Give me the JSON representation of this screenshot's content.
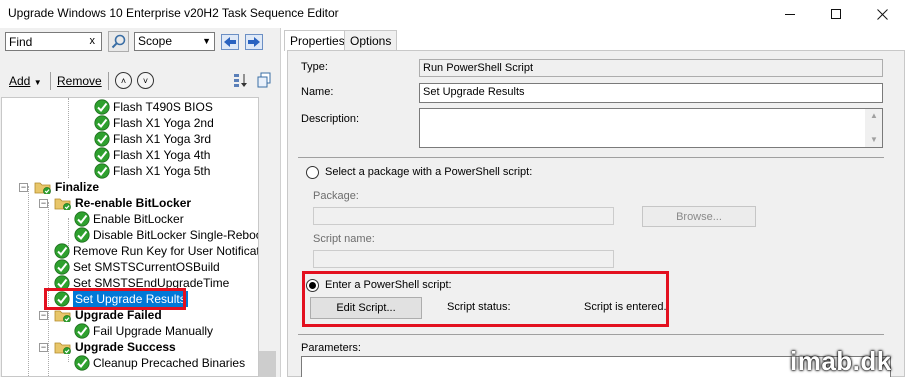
{
  "window": {
    "title": "Upgrade Windows 10 Enterprise v20H2 Task Sequence Editor",
    "controls": [
      "minimize-icon",
      "maximize-icon",
      "close-icon"
    ]
  },
  "search": {
    "value": "Find",
    "clear_label": "x",
    "scope_value": "Scope"
  },
  "toolbar": {
    "add_label": "Add",
    "remove_label": "Remove"
  },
  "tree": {
    "items": [
      {
        "label": "Flash T490S BIOS",
        "type": "step"
      },
      {
        "label": "Flash X1 Yoga 2nd",
        "type": "step"
      },
      {
        "label": "Flash X1 Yoga 3rd",
        "type": "step"
      },
      {
        "label": "Flash X1 Yoga 4th",
        "type": "step"
      },
      {
        "label": "Flash X1 Yoga 5th",
        "type": "step"
      },
      {
        "label": "Finalize",
        "type": "group"
      },
      {
        "label": "Re-enable BitLocker",
        "type": "group"
      },
      {
        "label": "Enable BitLocker",
        "type": "step"
      },
      {
        "label": "Disable BitLocker Single-Reboot",
        "type": "step"
      },
      {
        "label": "Remove Run Key for User Notification",
        "type": "step"
      },
      {
        "label": "Set SMSTSCurrentOSBuild",
        "type": "step"
      },
      {
        "label": "Set SMSTSEndUpgradeTime",
        "type": "step"
      },
      {
        "label": "Set Upgrade Results",
        "type": "step",
        "selected": true
      },
      {
        "label": "Upgrade Failed",
        "type": "group"
      },
      {
        "label": "Fail Upgrade Manually",
        "type": "step"
      },
      {
        "label": "Upgrade Success",
        "type": "group"
      },
      {
        "label": "Cleanup Precached Binaries",
        "type": "step"
      }
    ]
  },
  "tabs": [
    {
      "label": "Properties",
      "active": true
    },
    {
      "label": "Options",
      "active": false
    }
  ],
  "properties": {
    "type_label": "Type:",
    "type_value": "Run PowerShell Script",
    "name_label": "Name:",
    "name_value": "Set Upgrade Results",
    "description_label": "Description:",
    "description_value": "",
    "option_package_label": "Select a package with a PowerShell script:",
    "package_label": "Package:",
    "browse_label": "Browse...",
    "script_name_label": "Script name:",
    "option_enter_label": "Enter a PowerShell script:",
    "edit_script_label": "Edit Script...",
    "script_status_label": "Script status:",
    "script_status_value": "Script is entered.",
    "parameters_label": "Parameters:"
  },
  "watermark": "imab.dk",
  "colors": {
    "selection": "#0078d7",
    "highlight_box": "#e3101f",
    "check_green": "#2ea02e"
  }
}
